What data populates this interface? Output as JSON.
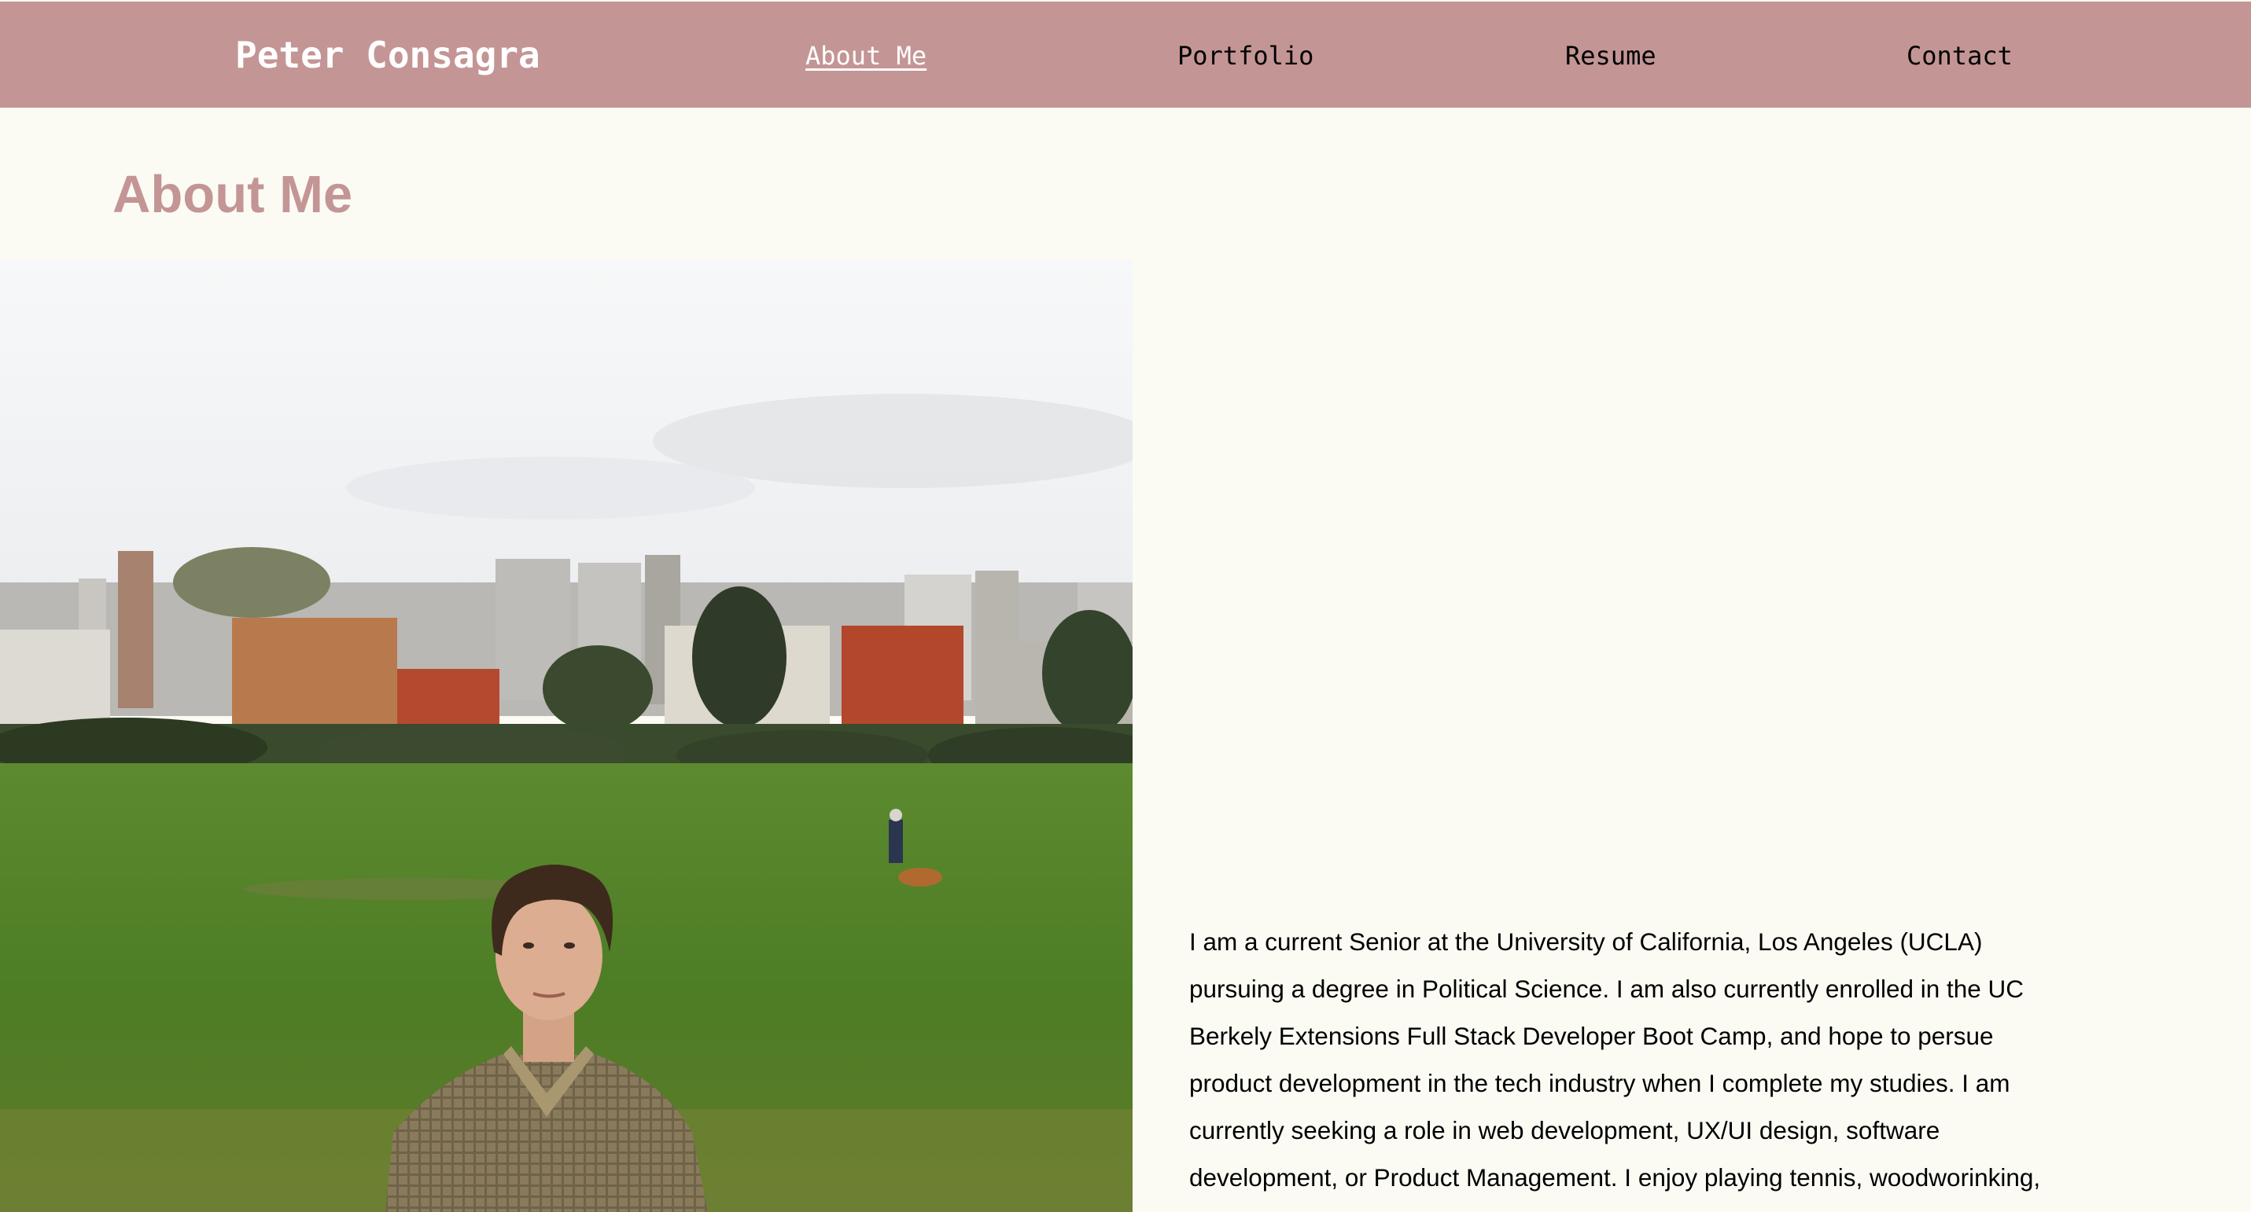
{
  "header": {
    "brand": "Peter Consagra",
    "nav": [
      {
        "label": "About Me",
        "active": true
      },
      {
        "label": "Portfolio",
        "active": false
      },
      {
        "label": "Resume",
        "active": false
      },
      {
        "label": "Contact",
        "active": false
      }
    ]
  },
  "main": {
    "heading": "About Me",
    "photo_alt": "Portrait photo",
    "bio_lines": [
      "I am a current Senior at the University of California, Los Angeles (UCLA)",
      "pursuing a degree in Political Science. I am also currently enrolled in the UC",
      "Berkely Extensions Full Stack Developer Boot Camp, and hope to persue",
      "product development in the tech industry when I complete my studies. I am",
      "currently seeking a role in web development, UX/UI design, software",
      "development, or Product Management. I enjoy playing tennis, woodworinking,"
    ]
  },
  "colors": {
    "navbar_bg": "#c49595",
    "page_bg": "#fbfbf4",
    "heading": "#c49595"
  }
}
